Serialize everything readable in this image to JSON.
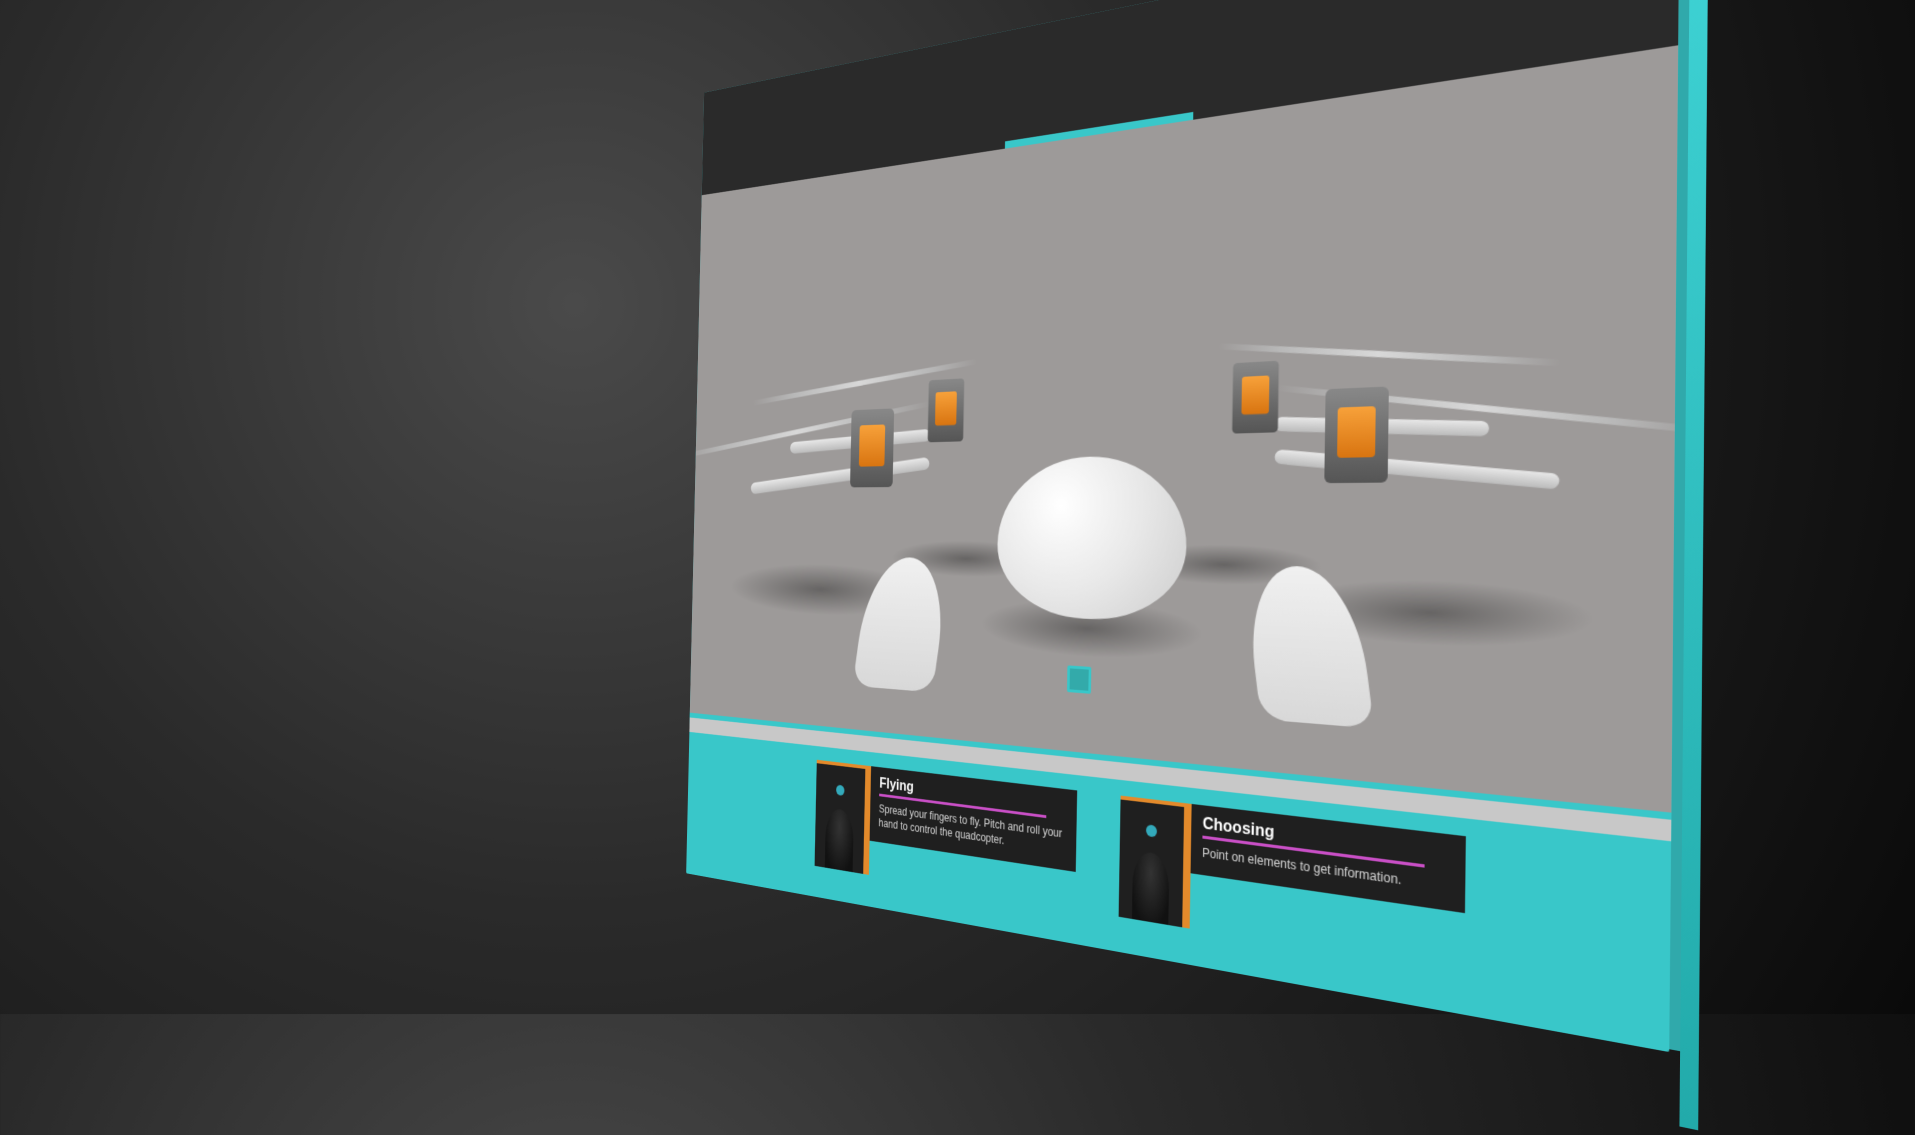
{
  "colors": {
    "accent_cyan": "#39c7c9",
    "accent_orange": "#e38a2b",
    "accent_magenta": "#c94fc6",
    "panel_dark": "#2a2a2a",
    "viewport_grey": "#9d9a99"
  },
  "viewport": {
    "subject": "quadcopter-drone",
    "cursor_icon": "selection-box"
  },
  "cards": [
    {
      "id": "flying",
      "title": "Flying",
      "description": "Spread your fingers to fly. Pitch and roll your hand to control the quadcopter.",
      "icon": "hand-gesture"
    },
    {
      "id": "choosing",
      "title": "Choosing",
      "description": "Point on elements to get information.",
      "icon": "hand-point"
    }
  ]
}
